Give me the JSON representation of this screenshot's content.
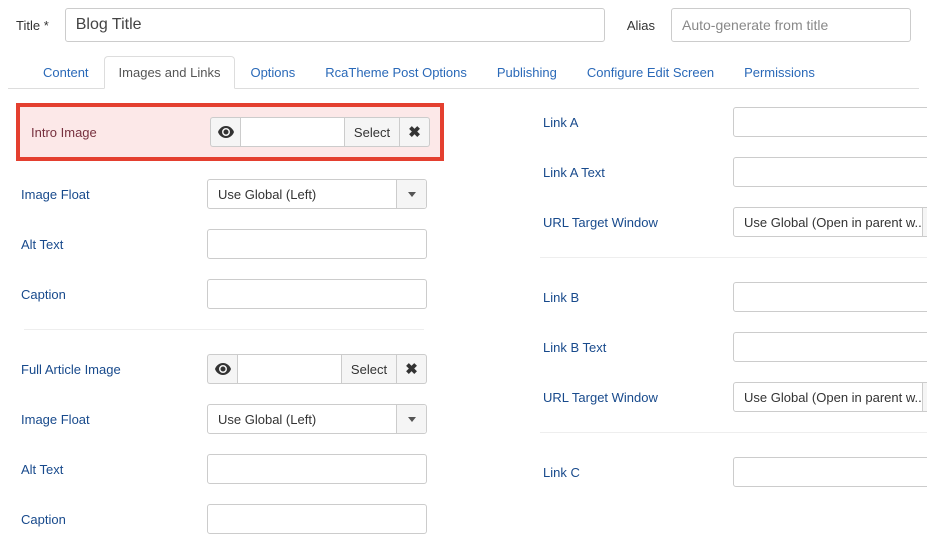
{
  "header": {
    "title_label": "Title *",
    "title_value": "Blog Title",
    "alias_label": "Alias",
    "alias_placeholder": "Auto-generate from title"
  },
  "tabs": [
    "Content",
    "Images and Links",
    "Options",
    "RcaTheme Post Options",
    "Publishing",
    "Configure Edit Screen",
    "Permissions"
  ],
  "left": {
    "intro_image_label": "Intro Image",
    "select_button": "Select",
    "image_float_label": "Image Float",
    "image_float_value": "Use Global (Left)",
    "alt_text_label": "Alt Text",
    "caption_label": "Caption",
    "full_article_image_label": "Full Article Image",
    "image_float2_label": "Image Float",
    "image_float2_value": "Use Global (Left)",
    "alt_text2_label": "Alt Text",
    "caption2_label": "Caption"
  },
  "right": {
    "link_a_label": "Link A",
    "link_a_text_label": "Link A Text",
    "url_target_label": "URL Target Window",
    "url_target_value": "Use Global (Open in parent w...",
    "link_b_label": "Link B",
    "link_b_text_label": "Link B Text",
    "url_target2_label": "URL Target Window",
    "url_target2_value": "Use Global (Open in parent w...",
    "link_c_label": "Link C"
  }
}
